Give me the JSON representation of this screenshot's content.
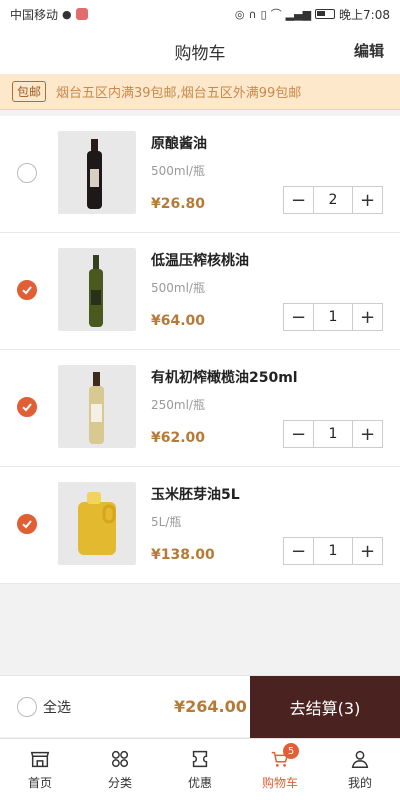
{
  "status": {
    "carrier": "中国移动",
    "time": "晚上7:08"
  },
  "nav": {
    "title": "购物车",
    "edit": "编辑"
  },
  "notice": {
    "tag": "包邮",
    "text": "烟台五区内满39包邮,烟台五区外满99包邮"
  },
  "items": [
    {
      "name": "原酿酱油",
      "spec": "500ml/瓶",
      "price": "¥26.80",
      "qty": "2",
      "checked": false
    },
    {
      "name": "低温压榨核桃油",
      "spec": "500ml/瓶",
      "price": "¥64.00",
      "qty": "1",
      "checked": true
    },
    {
      "name": "有机初榨橄榄油250ml",
      "spec": "250ml/瓶",
      "price": "¥62.00",
      "qty": "1",
      "checked": true
    },
    {
      "name": "玉米胚芽油5L",
      "spec": "5L/瓶",
      "price": "¥138.00",
      "qty": "1",
      "checked": true
    }
  ],
  "stepper": {
    "minus": "−",
    "plus": "+"
  },
  "checkout": {
    "select_all": "全选",
    "total": "¥264.00",
    "button": "去结算(3)"
  },
  "tabs": [
    {
      "label": "首页",
      "icon": "shop-icon"
    },
    {
      "label": "分类",
      "icon": "category-icon"
    },
    {
      "label": "优惠",
      "icon": "coupon-icon"
    },
    {
      "label": "购物车",
      "icon": "cart-icon",
      "badge": "5",
      "active": true
    },
    {
      "label": "我的",
      "icon": "user-icon"
    }
  ],
  "colors": {
    "accent": "#e15f35",
    "price": "#b57b36",
    "checkout_bg": "#4a2320",
    "notice_bg": "#fde8cc"
  }
}
